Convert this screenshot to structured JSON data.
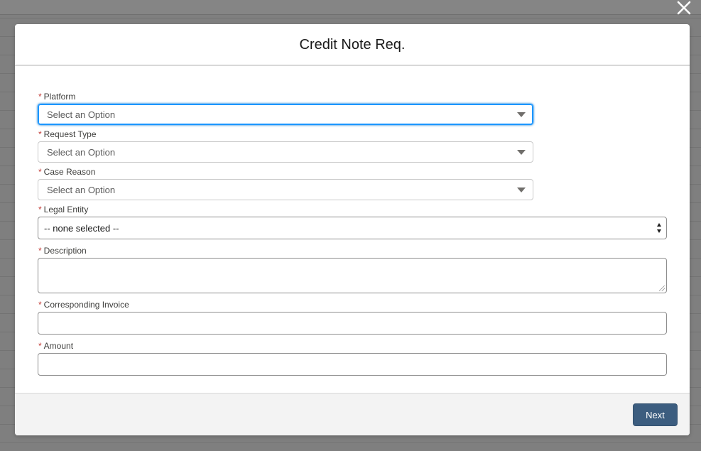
{
  "modal": {
    "title": "Credit Note Req."
  },
  "icons": {
    "close": "close-icon",
    "dropdown": "chevron-down-icon",
    "select_arrows": "up-down-arrows-icon"
  },
  "colors": {
    "required_marker": "#c23934",
    "focus_border": "#1b96ff",
    "primary_button": "#3c5d7f"
  },
  "fields": {
    "platform": {
      "required": "*",
      "label": "Platform",
      "placeholder": "Select an Option"
    },
    "request_type": {
      "required": "*",
      "label": "Request Type",
      "placeholder": "Select an Option"
    },
    "case_reason": {
      "required": "*",
      "label": "Case Reason",
      "placeholder": "Select an Option"
    },
    "legal_entity": {
      "required": "*",
      "label": "Legal Entity",
      "selected": "-- none selected --"
    },
    "description": {
      "required": "*",
      "label": "Description",
      "value": ""
    },
    "corresponding_invoice": {
      "required": "*",
      "label": "Corresponding Invoice",
      "value": ""
    },
    "amount": {
      "required": "*",
      "label": "Amount",
      "value": ""
    }
  },
  "footer": {
    "next_label": "Next"
  }
}
